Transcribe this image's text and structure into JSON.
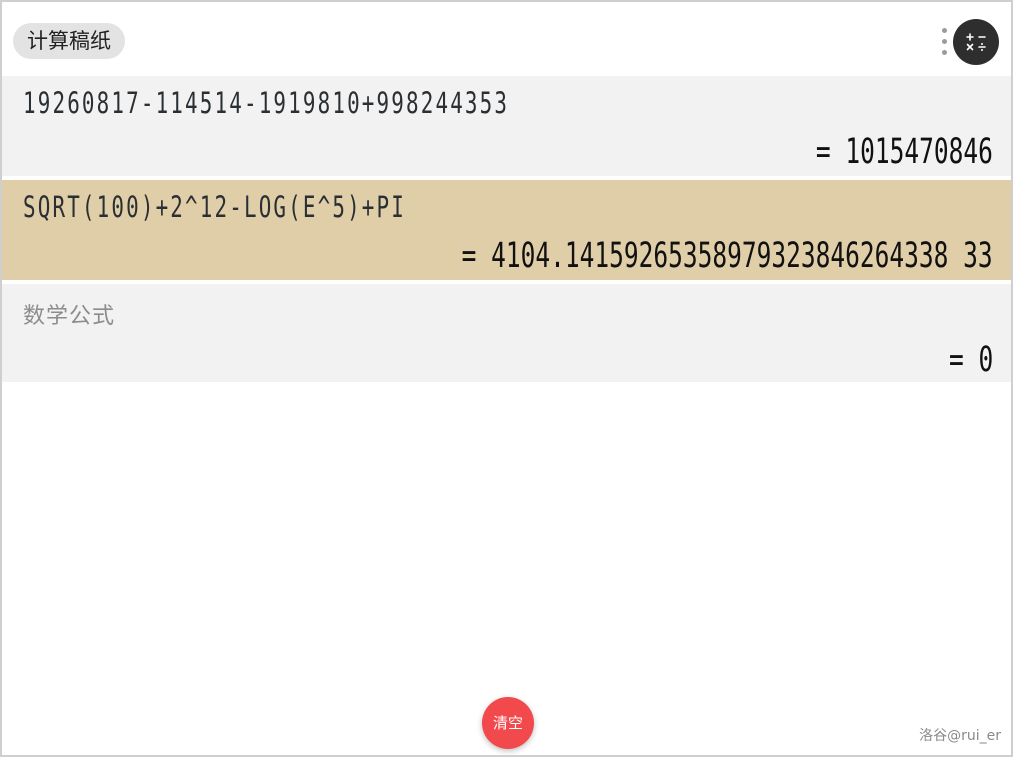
{
  "header": {
    "title": "计算稿纸",
    "menu_icon": "more-vertical-icon",
    "calculator_icon": "calculator-icon"
  },
  "entries": [
    {
      "expression": "19260817-114514-1919810+998244353",
      "result": "= 1015470846",
      "active": false
    },
    {
      "expression": "SQRT(100)+2^12-LOG(E^5)+PI",
      "result": "= 4104.14159265358979323846264338 33",
      "active": true
    },
    {
      "expression": "",
      "placeholder": "数学公式",
      "result": "= 0",
      "active": false
    }
  ],
  "footer": {
    "clear_label": "清空",
    "credit": "洛谷@rui_er"
  },
  "colors": {
    "row_background": "#f2f2f2",
    "active_row_background": "#e0cea8",
    "clear_button": "#f2494d",
    "calc_button": "#2e2e2e"
  }
}
